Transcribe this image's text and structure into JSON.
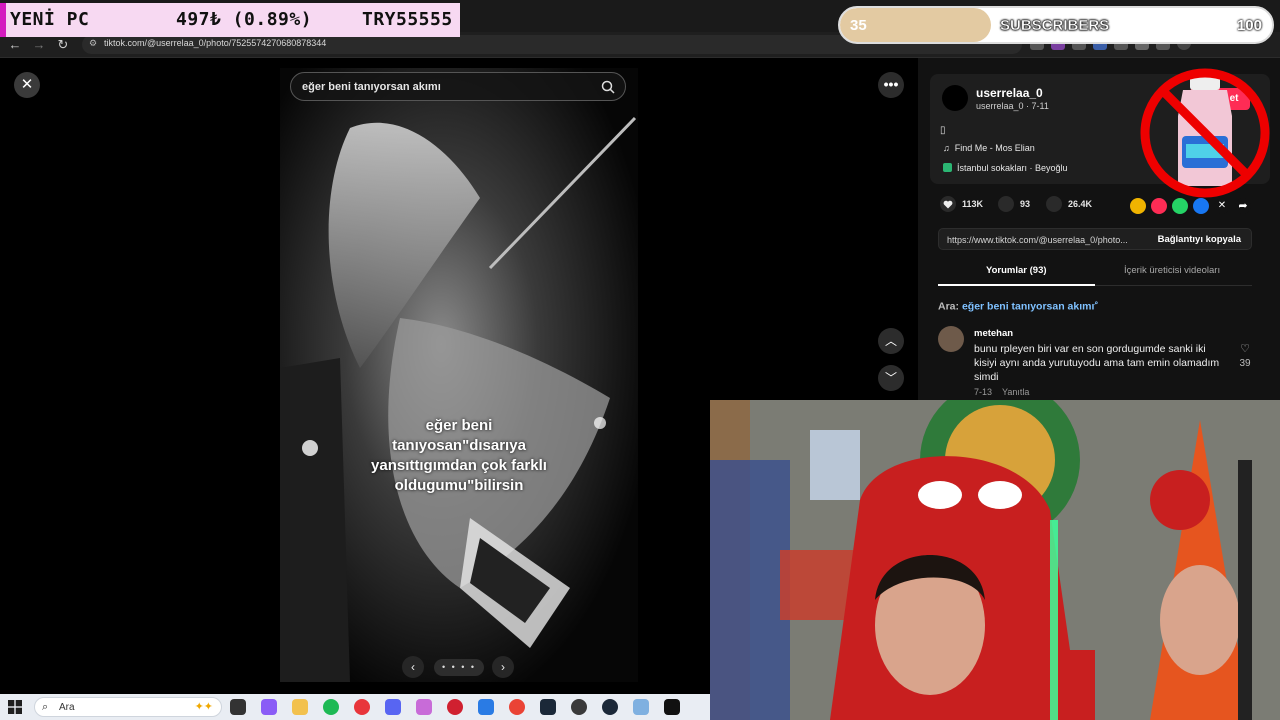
{
  "browser": {
    "url": "tiktok.com/@userrelaa_0/photo/7525574270680878344"
  },
  "overlay": {
    "ticker": {
      "name": "YENİ PC",
      "price": "497₺ (0.89%)",
      "code": "TRY55555"
    },
    "subscriber_goal": {
      "current": "35",
      "label": "SUBSCRIBERS",
      "target": "100",
      "progress_fraction": 0.35
    }
  },
  "post": {
    "search_query": "eğer beni tanıyorsan akımı",
    "caption": "eğer beni\ntanıyosan\"dısarıya\nyansıttıgımdan çok farklı\noldugumu\"bilirsin",
    "pager_dots": "• • • •"
  },
  "panel": {
    "username": "userrelaa_0",
    "handle_date": "userrelaa_0 · 7-11",
    "desc_glyph": "▯",
    "music": "Find Me - Mos Elian",
    "location": "İstanbul sokakları · Beyoğlu",
    "follow_label": "Takip et",
    "likes": "113K",
    "comments": "93",
    "saves": "26.4K",
    "link": "https://www.tiktok.com/@userrelaa_0/photo...",
    "copy_link": "Bağlantıyı kopyala",
    "tab_comments": "Yorumlar (93)",
    "tab_creator_videos": "İçerik üreticisi videoları",
    "search_prefix": "Ara:",
    "search_suggestion": "eğer beni tanıyorsan akımı",
    "comment": {
      "author": "metehan",
      "text": "bunu rpleyen biri var en son gordugumde sanki iki kisiyi aynı anda yurutuyodu ama tam emin olamadım simdi",
      "date": "7-13",
      "reply": "Yanıtla",
      "likes": "39"
    }
  },
  "taskbar": {
    "search_label": "Ara"
  },
  "colors": {
    "tiktok_red": "#fe2c55",
    "ticker_accent": "#d41bbf",
    "link_blue": "#7fc1ff"
  }
}
